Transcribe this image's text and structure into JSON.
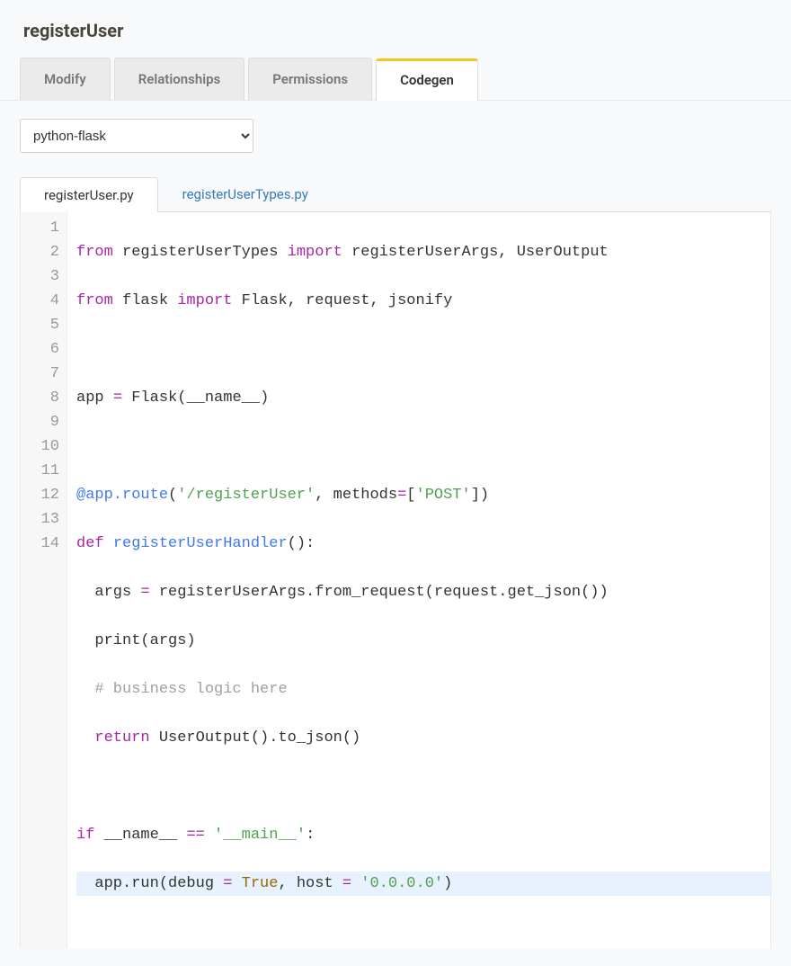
{
  "page": {
    "title": "registerUser"
  },
  "tabs": {
    "t0": "Modify",
    "t1": "Relationships",
    "t2": "Permissions",
    "t3": "Codegen"
  },
  "codegen": {
    "framework_selected": "python-flask"
  },
  "fileTabs": {
    "f0": "registerUser.py",
    "f1": "registerUserTypes.py"
  },
  "code": {
    "lines": {
      "n1": "1",
      "n2": "2",
      "n3": "3",
      "n4": "4",
      "n5": "5",
      "n6": "6",
      "n7": "7",
      "n8": "8",
      "n9": "9",
      "n10": "10",
      "n11": "11",
      "n12": "12",
      "n13": "13",
      "n14": "14"
    },
    "l1a": "from",
    "l1b": " registerUserTypes ",
    "l1c": "import",
    "l1d": " registerUserArgs, UserOutput",
    "l2a": "from",
    "l2b": " flask ",
    "l2c": "import",
    "l2d": " Flask, request, jsonify",
    "l3": " ",
    "l4a": "app ",
    "l4b": "=",
    "l4c": " Flask(",
    "l4d": "__name__",
    "l4e": ")",
    "l5": " ",
    "l6a": "@app.route",
    "l6b": "(",
    "l6c": "'/registerUser'",
    "l6d": ", methods",
    "l6e": "=",
    "l6f": "[",
    "l6g": "'POST'",
    "l6h": "])",
    "l7a": "def",
    "l7b": " ",
    "l7c": "registerUserHandler",
    "l7d": "():",
    "l8a": "  args ",
    "l8b": "=",
    "l8c": " registerUserArgs.from_request(request.get_json())",
    "l9": "  print(args)",
    "l10a": "  ",
    "l10b": "# business logic here",
    "l11a": "  ",
    "l11b": "return",
    "l11c": " UserOutput().to_json()",
    "l12": " ",
    "l13a": "if",
    "l13b": " __name__ ",
    "l13c": "==",
    "l13d": " ",
    "l13e": "'__main__'",
    "l13f": ":",
    "l14a": "  app.run(debug ",
    "l14b": "=",
    "l14c": " ",
    "l14d": "True",
    "l14e": ", host ",
    "l14f": "=",
    "l14g": " ",
    "l14h": "'0.0.0.0'",
    "l14i": ")"
  }
}
